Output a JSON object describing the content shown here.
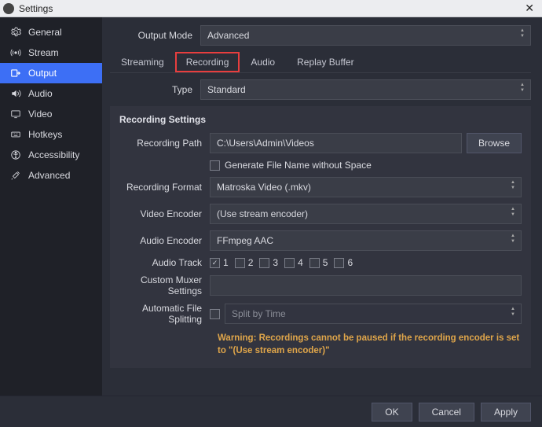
{
  "window": {
    "title": "Settings"
  },
  "sidebar": {
    "items": [
      {
        "label": "General"
      },
      {
        "label": "Stream"
      },
      {
        "label": "Output"
      },
      {
        "label": "Audio"
      },
      {
        "label": "Video"
      },
      {
        "label": "Hotkeys"
      },
      {
        "label": "Accessibility"
      },
      {
        "label": "Advanced"
      }
    ]
  },
  "output_mode": {
    "label": "Output Mode",
    "value": "Advanced"
  },
  "tabs": {
    "streaming": "Streaming",
    "recording": "Recording",
    "audio": "Audio",
    "replay_buffer": "Replay Buffer"
  },
  "type": {
    "label": "Type",
    "value": "Standard"
  },
  "panel": {
    "title": "Recording Settings"
  },
  "recording_path": {
    "label": "Recording Path",
    "value": "C:\\Users\\Admin\\Videos",
    "browse": "Browse"
  },
  "gen_filename": {
    "label": "Generate File Name without Space"
  },
  "recording_format": {
    "label": "Recording Format",
    "value": "Matroska Video (.mkv)"
  },
  "video_encoder": {
    "label": "Video Encoder",
    "value": "(Use stream encoder)"
  },
  "audio_encoder": {
    "label": "Audio Encoder",
    "value": "FFmpeg AAC"
  },
  "audio_track": {
    "label": "Audio Track",
    "tracks": [
      "1",
      "2",
      "3",
      "4",
      "5",
      "6"
    ]
  },
  "custom_muxer": {
    "label": "Custom Muxer Settings"
  },
  "auto_split": {
    "label": "Automatic File Splitting",
    "value": "Split by Time"
  },
  "warning": "Warning: Recordings cannot be paused if the recording encoder is set to \"(Use stream encoder)\"",
  "footer": {
    "ok": "OK",
    "cancel": "Cancel",
    "apply": "Apply"
  }
}
